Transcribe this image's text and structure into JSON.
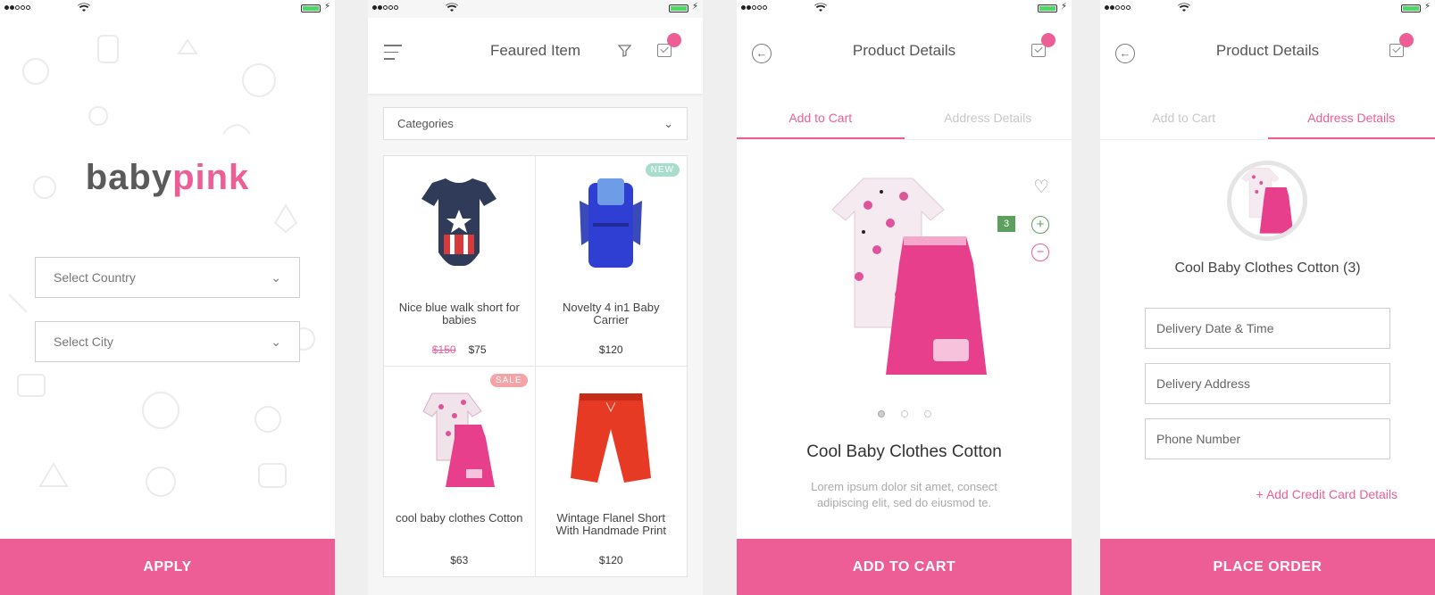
{
  "screen1": {
    "logo_part1": "baby",
    "logo_part2": "pink",
    "country": "Select Country",
    "city": "Select City",
    "apply": "APPLY"
  },
  "screen2": {
    "title": "Feaured Item",
    "categories": "Categories",
    "products": [
      {
        "name": "Nice blue walk short for babies",
        "old_price": "$150",
        "price": "$75",
        "tag": ""
      },
      {
        "name": "Novelty 4 in1 Baby Carrier",
        "old_price": "",
        "price": "$120",
        "tag": "NEW"
      },
      {
        "name": "cool baby clothes Cotton",
        "old_price": "",
        "price": "$63",
        "tag": "SALE"
      },
      {
        "name": "Wintage Flanel Short With Handmade Print",
        "old_price": "",
        "price": "$120",
        "tag": ""
      }
    ]
  },
  "screen3": {
    "title": "Product Details",
    "tab1": "Add to Cart",
    "tab2": "Address Details",
    "qty": "3",
    "product_name": "Cool Baby Clothes Cotton",
    "description": "Lorem ipsum dolor sit amet, consect adipiscing elit, sed do eiusmod te.",
    "button": "ADD TO CART"
  },
  "screen4": {
    "title": "Product Details",
    "tab1": "Add to Cart",
    "tab2": "Address Details",
    "product_name": "Cool Baby Clothes Cotton (3)",
    "field1": "Delivery Date & Time",
    "field2": "Delivery Address",
    "field3": "Phone Number",
    "add_cc": "Add Credit Card Details",
    "button": "PLACE ORDER"
  },
  "colors": {
    "accent": "#ee5e96",
    "green": "#5ca05f",
    "new_tag": "#a8dccd",
    "sale_tag": "#f4a3a6"
  }
}
